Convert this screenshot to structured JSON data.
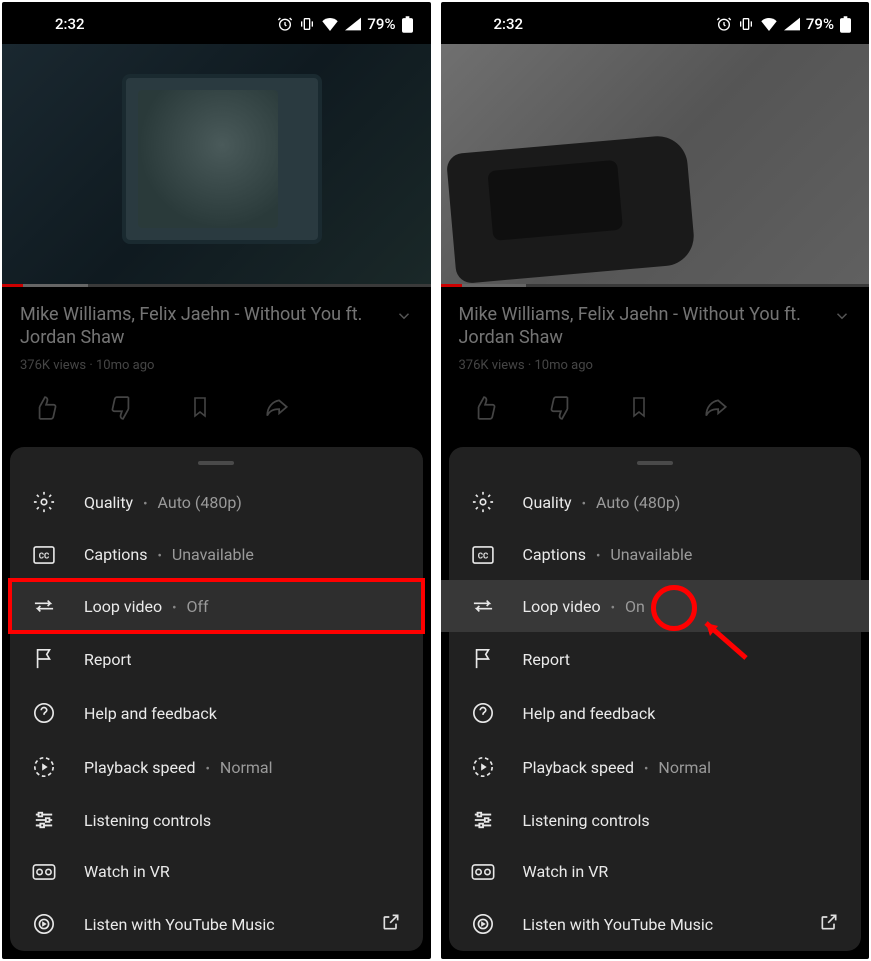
{
  "status": {
    "time": "2:32",
    "battery": "79%"
  },
  "video": {
    "title": "Mike Williams, Felix Jaehn - Without You ft. Jordan Shaw",
    "meta": "376K views · 10mo ago"
  },
  "menu": {
    "quality_label": "Quality",
    "quality_value": "Auto (480p)",
    "captions_label": "Captions",
    "captions_value": "Unavailable",
    "loop_label": "Loop video",
    "loop_value_off": "Off",
    "loop_value_on": "On",
    "report_label": "Report",
    "help_label": "Help and feedback",
    "speed_label": "Playback speed",
    "speed_value": "Normal",
    "listening_label": "Listening controls",
    "vr_label": "Watch in VR",
    "ytmusic_label": "Listen with YouTube Music"
  }
}
